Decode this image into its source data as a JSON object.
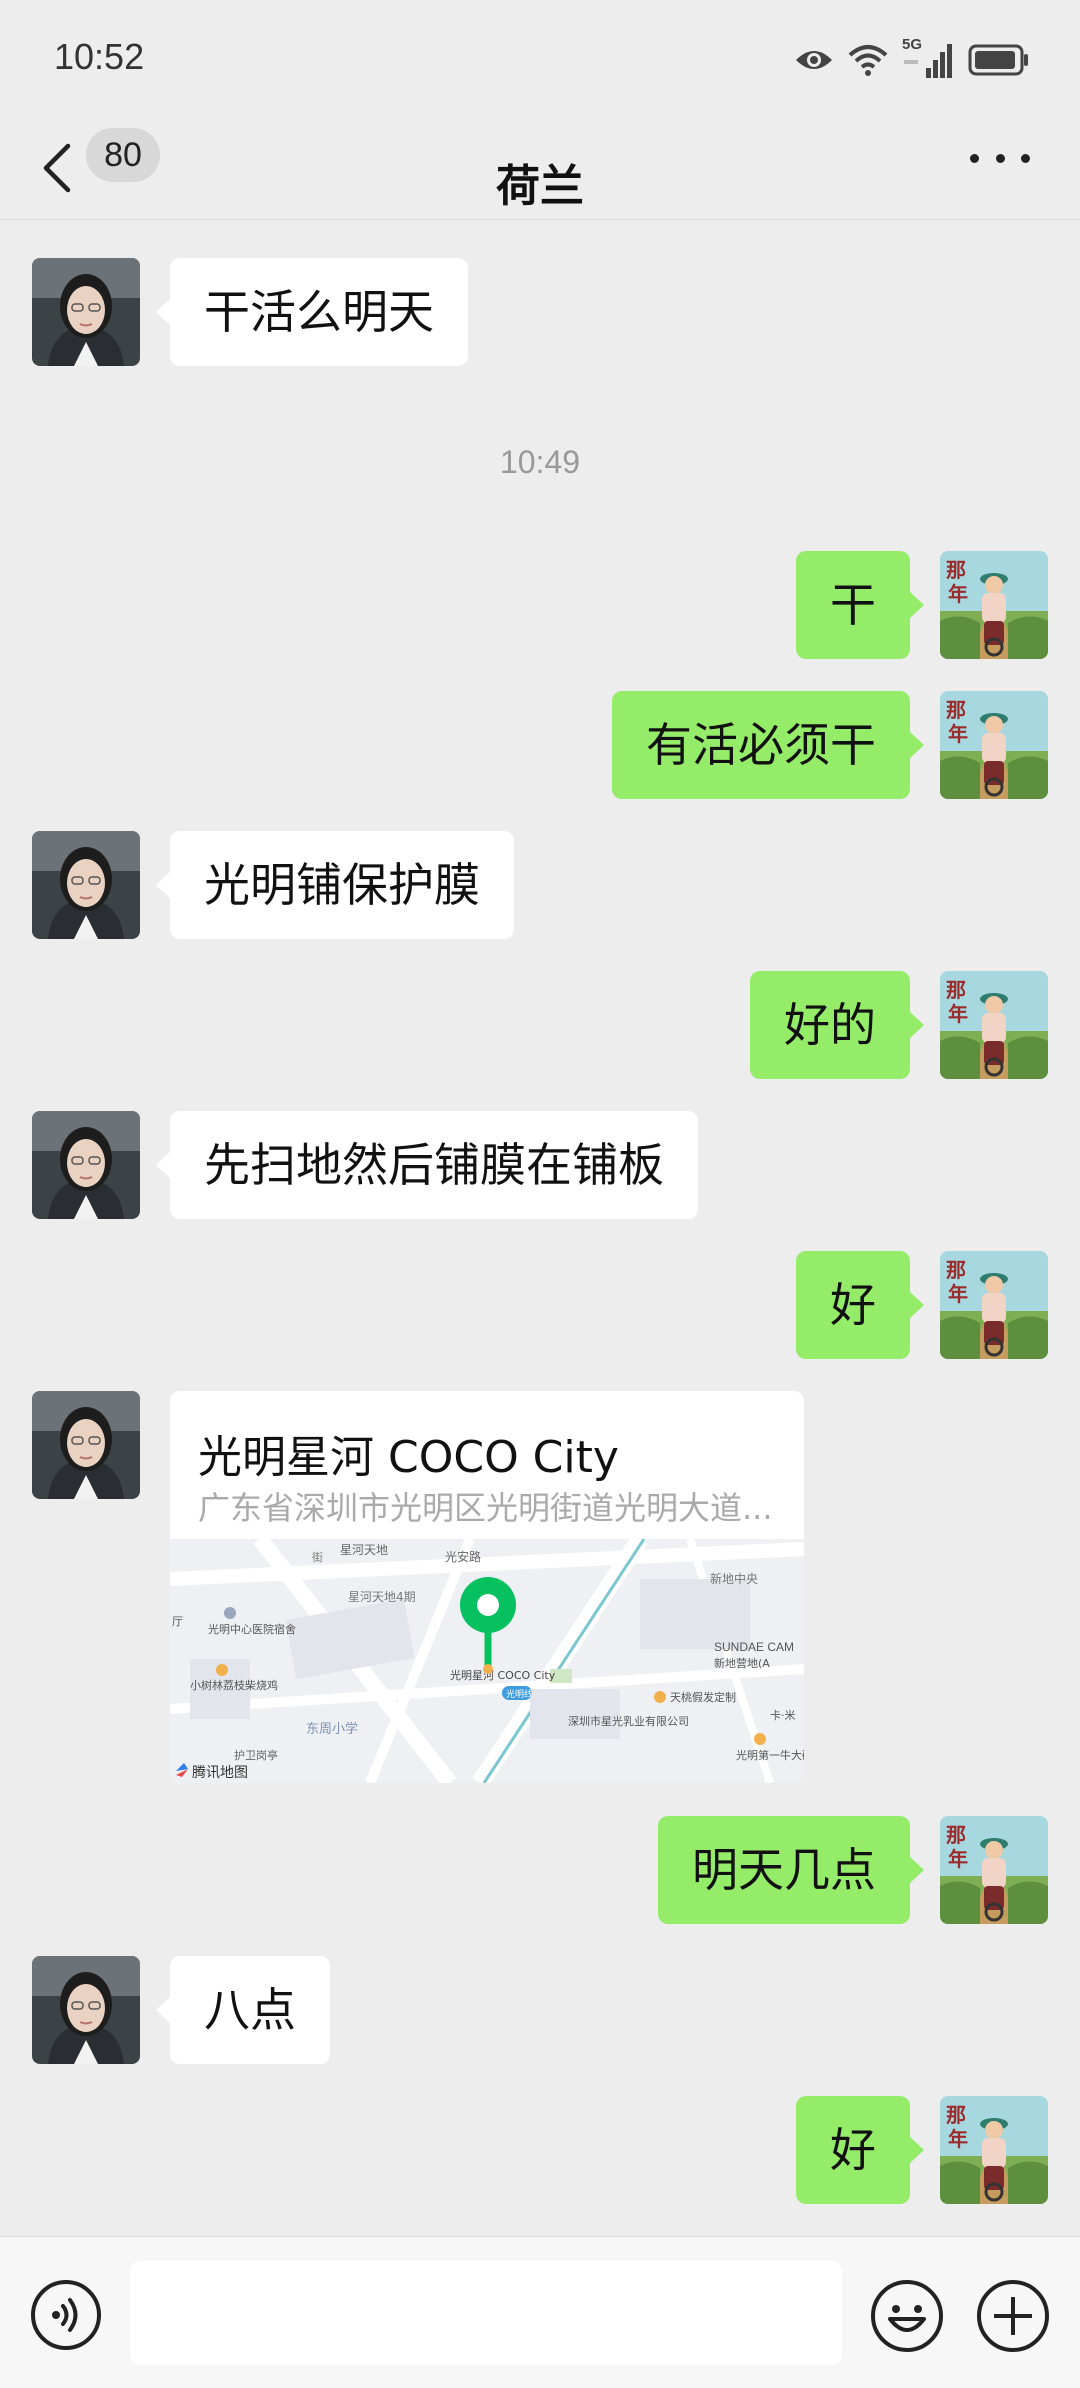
{
  "status": {
    "time": "10:52",
    "network": "5G"
  },
  "nav": {
    "title": "荷兰",
    "unread_count": "80"
  },
  "timestamp": "10:49",
  "messages": {
    "m1": "干活么明天",
    "m2": "干",
    "m3": "有活必须干",
    "m4": "光明铺保护膜",
    "m5": "好的",
    "m6": "先扫地然后铺膜在铺板",
    "m7": "好",
    "m9": "明天几点",
    "m10": "八点",
    "m11": "好"
  },
  "location": {
    "name": "光明星河 COCO City",
    "address": "广东省深圳市光明区光明街道光明大道...",
    "map_provider": "腾讯地图",
    "map_labels": {
      "l1": "星河天地",
      "l2": "光安路",
      "l3": "新地中央",
      "l4": "星河天地4期",
      "l5": "光明中心医院宿舍",
      "l6": "小树林荔枝柴烧鸡",
      "l7": "东周小学",
      "l8": "护卫岗亭",
      "l9": "光明星河 COCO City",
      "l10": "光明线",
      "l11": "深圳市星光乳业有限公司",
      "l12": "天桃假发定制",
      "l13": "SUNDAE CAM",
      "l14": "新地营地(A",
      "l15": "卡·米",
      "l16": "光明第一牛大碗店",
      "l17": "厅",
      "l18": "街"
    }
  },
  "colors": {
    "out_bubble": "#95ec69",
    "in_bubble": "#ffffff",
    "background": "#ededed",
    "pin": "#07c160"
  },
  "icons": {
    "back": "chevron-left-icon",
    "more": "more-dots-icon",
    "voice": "voice-icon",
    "emoji": "emoji-icon",
    "plus": "plus-icon",
    "eye": "eye-icon",
    "wifi": "wifi-icon",
    "signal": "signal-icon",
    "battery": "battery-icon"
  }
}
